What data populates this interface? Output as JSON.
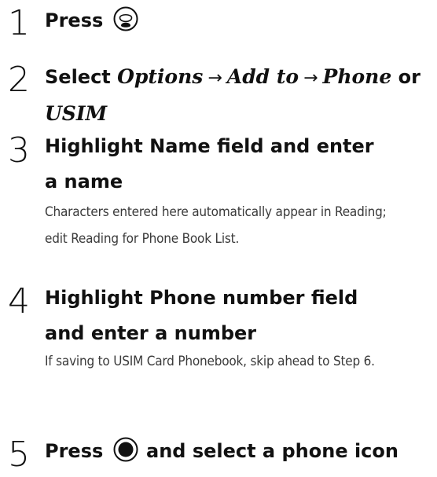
{
  "steps": [
    {
      "number": "1",
      "title_pre": "Press",
      "icon": "call-end-key-icon"
    },
    {
      "number": "2",
      "title_pre": "Select ",
      "menu_path": [
        "Options",
        "Add to",
        "Phone"
      ],
      "arrow": "→",
      "connector": " or ",
      "title_post_italic": "USIM"
    },
    {
      "number": "3",
      "title": "Highlight Name field and enter a name",
      "description": "Characters entered here automatically appear in Reading; edit Reading for Phone Book List."
    },
    {
      "number": "4",
      "title": "Highlight Phone number field and enter a number",
      "description": "If saving to USIM Card Phonebook, skip ahead to Step 6."
    },
    {
      "number": "5",
      "title_pre": "Press",
      "icon": "center-select-key-icon",
      "title_post": " and select a phone icon"
    }
  ]
}
